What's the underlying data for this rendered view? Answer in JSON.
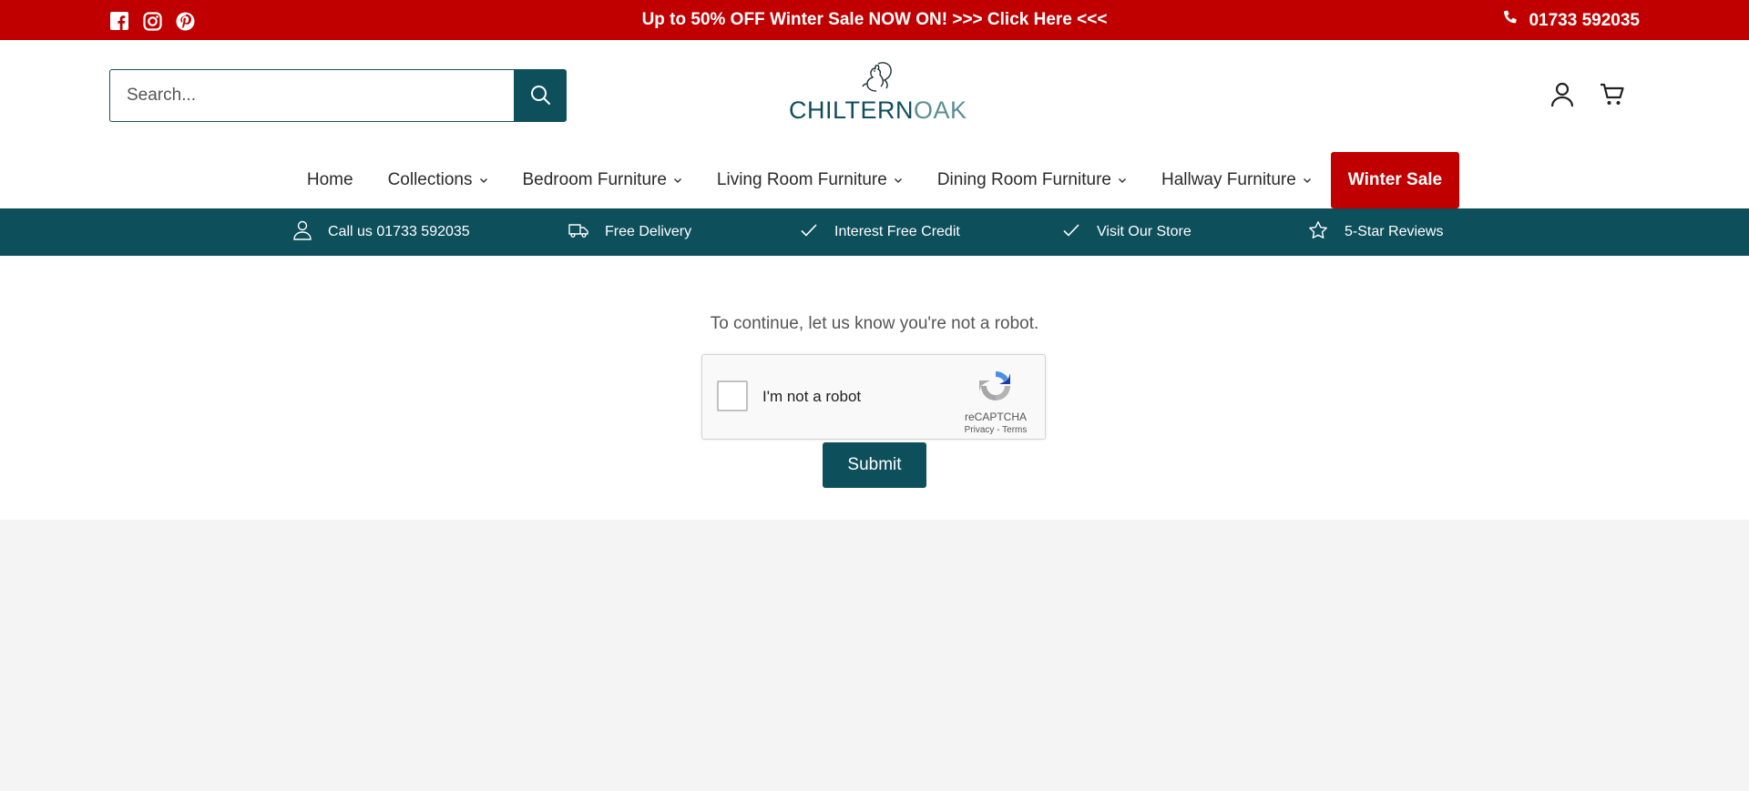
{
  "announcement": {
    "text": "Up to 50% OFF Winter Sale NOW ON! >>> Click Here <<<",
    "phone": "01733 592035",
    "social": [
      "facebook-icon",
      "instagram-icon",
      "pinterest-icon"
    ]
  },
  "header": {
    "search_placeholder": "Search...",
    "logo_part1": "CHILTERN",
    "logo_part2": "OAK"
  },
  "nav": {
    "items": [
      {
        "label": "Home",
        "dropdown": false
      },
      {
        "label": "Collections",
        "dropdown": true
      },
      {
        "label": "Bedroom Furniture",
        "dropdown": true
      },
      {
        "label": "Living Room Furniture",
        "dropdown": true
      },
      {
        "label": "Dining Room Furniture",
        "dropdown": true
      },
      {
        "label": "Hallway Furniture",
        "dropdown": true
      }
    ],
    "sale_label": "Winter Sale"
  },
  "usp": [
    {
      "icon": "person-icon",
      "label": "Call us 01733 592035"
    },
    {
      "icon": "delivery-truck-icon",
      "label": "Free Delivery"
    },
    {
      "icon": "check-icon",
      "label": "Interest Free Credit"
    },
    {
      "icon": "check-icon",
      "label": "Visit Our Store"
    },
    {
      "icon": "star-icon",
      "label": "5-Star Reviews"
    }
  ],
  "main": {
    "prompt": "To continue, let us know you're not a robot.",
    "captcha_label": "I'm not a robot",
    "captcha_brand": "reCAPTCHA",
    "captcha_links": "Privacy - Terms",
    "submit_label": "Submit"
  },
  "colors": {
    "announcement_bg": "#c00000",
    "brand_teal": "#0e4f5c",
    "sale_red": "#c00000",
    "footer_gray": "#f4f4f4"
  }
}
